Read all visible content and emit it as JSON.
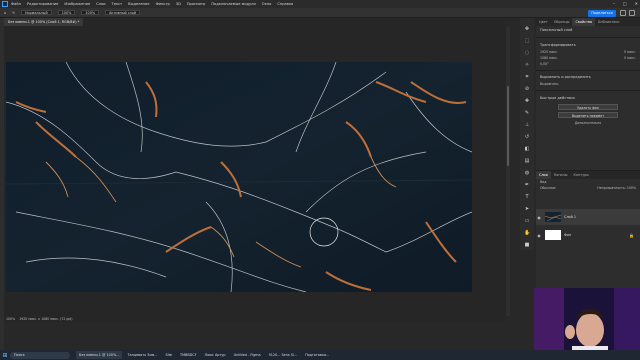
{
  "menubar": {
    "items": [
      "Файл",
      "Редактирование",
      "Изображение",
      "Слои",
      "Текст",
      "Выделение",
      "Фильтр",
      "3D",
      "Просмотр",
      "Подключаемые модули",
      "Окно",
      "Справка"
    ]
  },
  "options": {
    "mode": "Нормальный",
    "opacity": "100%",
    "flow": "100%",
    "sample": "Активный слой",
    "share_label": "Поделиться"
  },
  "document_tab": {
    "title": "Без имени-1 @ 100% (Слой 1, RGB/8#) *"
  },
  "status": {
    "zoom": "100%",
    "info": "1920 пикс. x 1080 пикс. (72 ppi)"
  },
  "panel": {
    "tabs": [
      "Цвет",
      "Образцы",
      "Свойства",
      "Библиотеки"
    ],
    "pixel_layer": "Пиксельный слой",
    "transform_title": "Трансформировать",
    "w_value": "1920 пикс.",
    "h_value": "1080 пикс.",
    "x_value": "0 пикс.",
    "y_value": "0 пикс.",
    "angle": "0,00°",
    "align_title": "Выровнять и распределить",
    "align_sub": "Выровнять:",
    "quick_actions_title": "Быстрые действия",
    "remove_bg": "Удалить фон",
    "select_subject": "Выделить предмет",
    "more": "Дополнительно"
  },
  "layers_panel": {
    "tabs": [
      "Слои",
      "Каналы",
      "Контуры"
    ],
    "search_placeholder": "Вид",
    "blend_mode": "Обычные",
    "opacity_label": "Непрозрачность: 100%",
    "layers": [
      {
        "name": "Слой 1",
        "selected": true
      },
      {
        "name": "Фон",
        "selected": false
      }
    ]
  },
  "taskbar": {
    "search_label": "Поиск",
    "apps": [
      "Без имени-1 @ 100%...",
      "Танцевать Зим...",
      "Site",
      "TMBBDCF",
      "Люкс Артур",
      "Untitled - Figma",
      "9120... Sens Si...",
      "Подготовка..."
    ]
  },
  "colors": {
    "accent": "#1473e6",
    "marble_dark": "#12202e",
    "vein_orange": "#c8743a"
  }
}
